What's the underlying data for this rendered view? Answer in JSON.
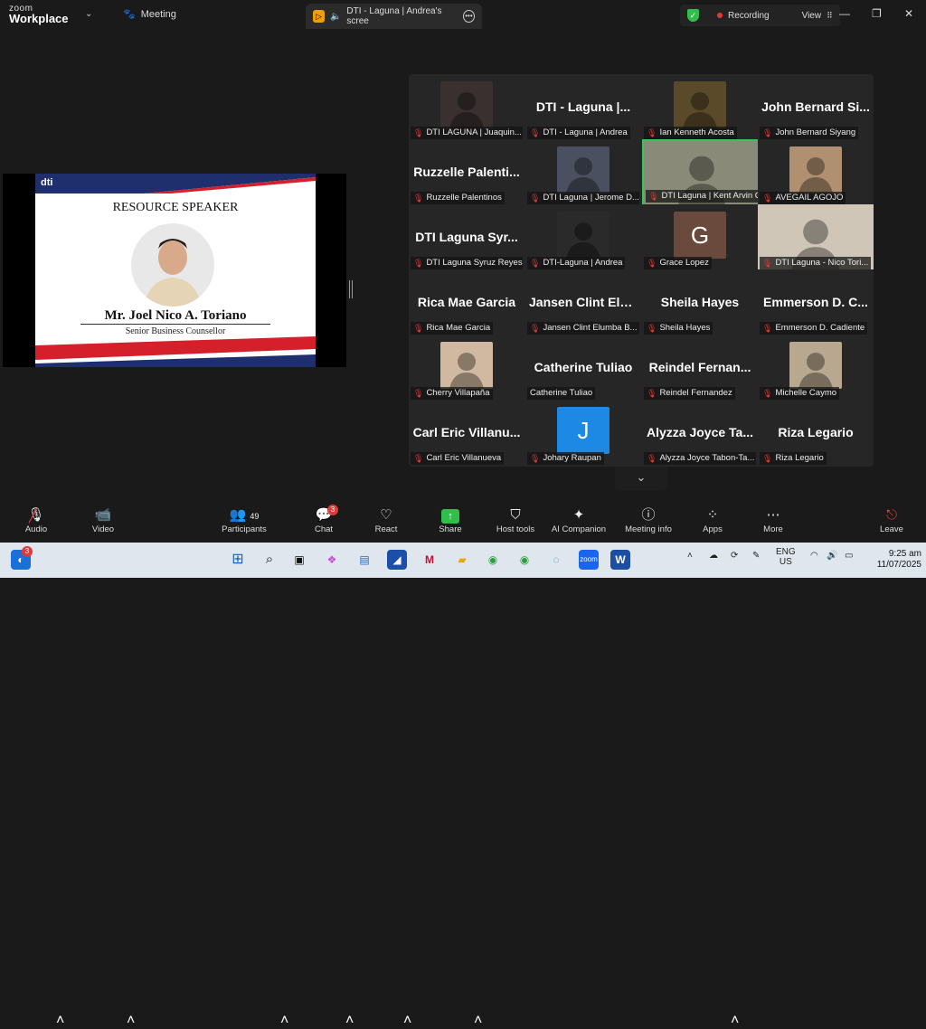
{
  "app": {
    "brand_top": "zoom",
    "brand_bottom": "Workplace",
    "meeting_label": "Meeting"
  },
  "share_tab": {
    "title": "DTI - Laguna | Andrea's scree"
  },
  "status": {
    "recording": "Recording",
    "view": "View"
  },
  "slide": {
    "logo": "dti",
    "title": "RESOURCE SPEAKER",
    "speaker_name": "Mr. Joel Nico A. Toriano",
    "speaker_role": "Senior Business Counsellor"
  },
  "participants": [
    {
      "label": "DTI LAGUNA | Juaquin...",
      "big": "",
      "kind": "video",
      "color": "#3a3030"
    },
    {
      "label": "DTI - Laguna | Andrea",
      "big": "DTI - Laguna |...",
      "kind": "name"
    },
    {
      "label": "Ian Kenneth Acosta",
      "big": "",
      "kind": "video",
      "color": "#5a4a2a"
    },
    {
      "label": "John Bernard Siyang",
      "big": "John Bernard Si...",
      "kind": "name"
    },
    {
      "label": "Ruzzelle Palentinos",
      "big": "Ruzzelle Palenti...",
      "kind": "name"
    },
    {
      "label": "DTI Laguna | Jerome D...",
      "big": "",
      "kind": "video",
      "color": "#4a5060"
    },
    {
      "label": "DTI Laguna | Kent Arvin C...",
      "big": "",
      "kind": "full",
      "color": "#8a8a78"
    },
    {
      "label": "AVEGAIL AGOJO",
      "big": "",
      "kind": "video",
      "color": "#b09070"
    },
    {
      "label": "DTI Laguna Syruz Reyes",
      "big": "DTI Laguna Syr...",
      "kind": "name"
    },
    {
      "label": "DTI-Laguna | Andrea",
      "big": "",
      "kind": "video",
      "color": "#2a2a2a"
    },
    {
      "label": "Grace Lopez",
      "big": "",
      "kind": "letter",
      "letter": "G",
      "color": "#6b4a3e"
    },
    {
      "label": "DTI Laguna - Nico Tori...",
      "big": "",
      "kind": "full",
      "color": "#cfc6b8"
    },
    {
      "label": "Rica Mae Garcia",
      "big": "Rica Mae Garcia",
      "kind": "name"
    },
    {
      "label": "Jansen Clint Elumba B...",
      "big": "Jansen Clint Elu...",
      "kind": "name"
    },
    {
      "label": "Sheila Hayes",
      "big": "Sheila Hayes",
      "kind": "name"
    },
    {
      "label": "Emmerson D. Cadiente",
      "big": "Emmerson D. C...",
      "kind": "name"
    },
    {
      "label": "Cherry Villapaña",
      "big": "",
      "kind": "video",
      "color": "#d0b9a0"
    },
    {
      "label": "Catherine Tuliao",
      "big": "Catherine Tuliao",
      "kind": "name",
      "nomic": true
    },
    {
      "label": "Reindel Fernandez",
      "big": "Reindel Fernan...",
      "kind": "name"
    },
    {
      "label": "Michelle Caymo",
      "big": "",
      "kind": "video",
      "color": "#b8a890"
    },
    {
      "label": "Carl Eric Villanueva",
      "big": "Carl Eric Villanu...",
      "kind": "name"
    },
    {
      "label": "Johary Raupan",
      "big": "",
      "kind": "letter",
      "letter": "J",
      "color": "#1e88e5"
    },
    {
      "label": "Alyzza Joyce Tabon-Ta...",
      "big": "Alyzza Joyce Ta...",
      "kind": "name"
    },
    {
      "label": "Riza Legario",
      "big": "Riza Legario",
      "kind": "name"
    }
  ],
  "toolbar": {
    "audio": "Audio",
    "audio_badge": "",
    "video": "Video",
    "participants": "Participants",
    "participants_count": "49",
    "chat": "Chat",
    "chat_badge": "3",
    "react": "React",
    "share": "Share",
    "host_tools": "Host tools",
    "ai_companion": "AI Companion",
    "meeting_info": "Meeting info",
    "apps": "Apps",
    "more": "More",
    "leave": "Leave"
  },
  "taskbar": {
    "start_badge": "3",
    "lang_top": "ENG",
    "lang_bottom": "US",
    "time": "9:25 am",
    "date": "11/07/2025"
  }
}
